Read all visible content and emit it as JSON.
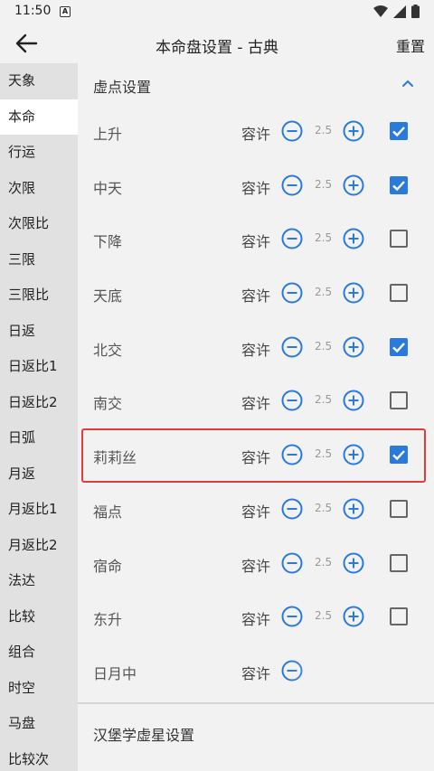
{
  "status_bar": {
    "time": "11:50",
    "notif_letter": "A"
  },
  "app_bar": {
    "title": "本命盘设置 - 古典",
    "reset_label": "重置"
  },
  "sidebar": {
    "items": [
      {
        "label": "天象"
      },
      {
        "label": "本命"
      },
      {
        "label": "行运"
      },
      {
        "label": "次限"
      },
      {
        "label": "次限比"
      },
      {
        "label": "三限"
      },
      {
        "label": "三限比"
      },
      {
        "label": "日返"
      },
      {
        "label": "日返比1"
      },
      {
        "label": "日返比2"
      },
      {
        "label": "日弧"
      },
      {
        "label": "月返"
      },
      {
        "label": "月返比1"
      },
      {
        "label": "月返比2"
      },
      {
        "label": "法达"
      },
      {
        "label": "比较"
      },
      {
        "label": "组合"
      },
      {
        "label": "时空"
      },
      {
        "label": "马盘"
      },
      {
        "label": "比较次"
      }
    ],
    "active_index": 1
  },
  "section": {
    "label": "虚点设置"
  },
  "rows": [
    {
      "name": "上升",
      "tolerance_label": "容许",
      "value": "2.5",
      "checked": true
    },
    {
      "name": "中天",
      "tolerance_label": "容许",
      "value": "2.5",
      "checked": true
    },
    {
      "name": "下降",
      "tolerance_label": "容许",
      "value": "2.5",
      "checked": false
    },
    {
      "name": "天底",
      "tolerance_label": "容许",
      "value": "2.5",
      "checked": false
    },
    {
      "name": "北交",
      "tolerance_label": "容许",
      "value": "2.5",
      "checked": true
    },
    {
      "name": "南交",
      "tolerance_label": "容许",
      "value": "2.5",
      "checked": false
    },
    {
      "name": "莉莉丝",
      "tolerance_label": "容许",
      "value": "2.5",
      "checked": true
    },
    {
      "name": "福点",
      "tolerance_label": "容许",
      "value": "2.5",
      "checked": false
    },
    {
      "name": "宿命",
      "tolerance_label": "容许",
      "value": "2.5",
      "checked": false
    },
    {
      "name": "东升",
      "tolerance_label": "容许",
      "value": "2.5",
      "checked": false
    },
    {
      "name": "日月中",
      "tolerance_label": "容许"
    }
  ],
  "highlighted_row_index": 6,
  "section2": {
    "label": "汉堡学虚星设置"
  },
  "colors": {
    "accent": "#2a7ad9",
    "highlight": "#e23b3b"
  }
}
